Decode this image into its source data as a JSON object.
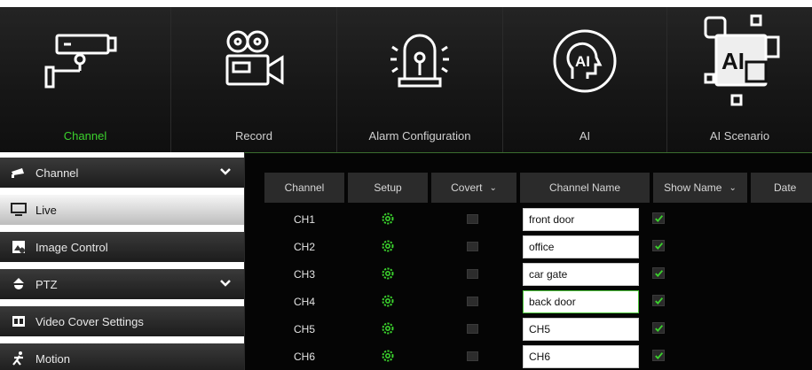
{
  "top_nav": [
    {
      "label": "Channel",
      "icon": "cctv-camera-icon",
      "active": true
    },
    {
      "label": "Record",
      "icon": "film-camera-icon",
      "active": false
    },
    {
      "label": "Alarm Configuration",
      "icon": "alarm-siren-icon",
      "active": false
    },
    {
      "label": "AI",
      "icon": "ai-head-icon",
      "active": false
    },
    {
      "label": "AI Scenario",
      "icon": "ai-scenario-icon",
      "active": false
    }
  ],
  "sidebar": [
    {
      "label": "Channel",
      "icon": "camera-icon",
      "expandable": true,
      "selected": false
    },
    {
      "label": "Live",
      "icon": "monitor-icon",
      "expandable": false,
      "selected": true
    },
    {
      "label": "Image Control",
      "icon": "image-control-icon",
      "expandable": false,
      "selected": false
    },
    {
      "label": "PTZ",
      "icon": "ptz-dome-icon",
      "expandable": true,
      "selected": false
    },
    {
      "label": "Video Cover Settings",
      "icon": "video-cover-icon",
      "expandable": false,
      "selected": false
    },
    {
      "label": "Motion",
      "icon": "running-person-icon",
      "expandable": false,
      "selected": false
    }
  ],
  "table": {
    "headers": {
      "channel": "Channel",
      "setup": "Setup",
      "covert": "Covert",
      "channel_name": "Channel Name",
      "show_name": "Show Name",
      "date": "Date"
    },
    "rows": [
      {
        "channel": "CH1",
        "name": "front door",
        "covert": false,
        "show_name": true
      },
      {
        "channel": "CH2",
        "name": "office",
        "covert": false,
        "show_name": true
      },
      {
        "channel": "CH3",
        "name": "car gate",
        "covert": false,
        "show_name": true
      },
      {
        "channel": "CH4",
        "name": "back door",
        "covert": false,
        "show_name": true
      },
      {
        "channel": "CH5",
        "name": "CH5",
        "covert": false,
        "show_name": true
      },
      {
        "channel": "CH6",
        "name": "CH6",
        "covert": false,
        "show_name": true
      }
    ]
  },
  "colors": {
    "accent_green": "#3bd12d",
    "panel_dark": "#050505",
    "header_gray": "#2b2b2b"
  }
}
